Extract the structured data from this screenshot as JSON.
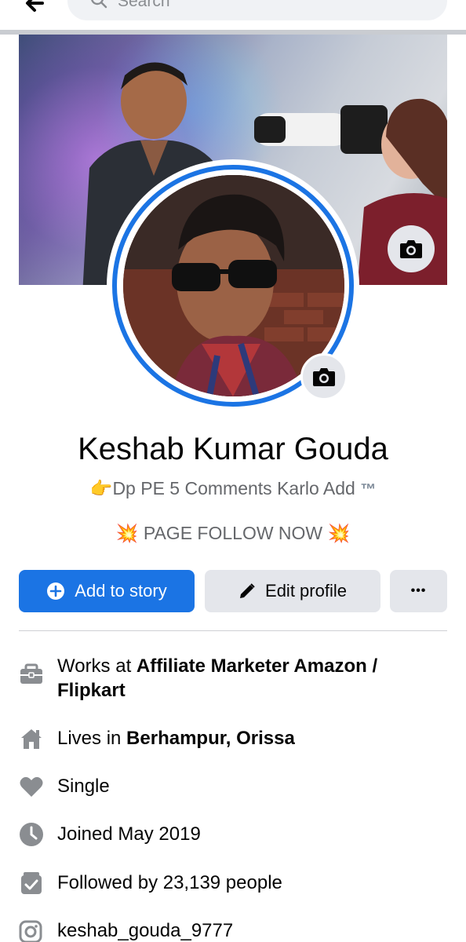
{
  "search": {
    "placeholder": "Search"
  },
  "profile": {
    "name": "Keshab Kumar Gouda",
    "bio_line1_emoji": "👉",
    "bio_line1": "Dp PE 5 Comments Karlo Add",
    "bio_line1_tm": "™",
    "bio_line2_emoji_left": "💥",
    "bio_line2": "PAGE FOLLOW NOW",
    "bio_line2_emoji_right": "💥"
  },
  "buttons": {
    "add_story": "Add to story",
    "edit_profile": "Edit profile",
    "more": "•••"
  },
  "info": {
    "work_prefix": "Works at ",
    "work_value": "Affiliate Marketer Amazon / Flipkart",
    "lives_prefix": "Lives in ",
    "lives_value": "Berhampur, Orissa",
    "relationship": "Single",
    "joined": "Joined May 2019",
    "followers": "Followed by 23,139 people",
    "instagram": "keshab_gouda_9777"
  },
  "icons": {
    "back": "back-arrow-icon",
    "search": "search-icon",
    "camera": "camera-icon",
    "plus": "plus-circle-icon",
    "pencil": "pencil-icon",
    "work": "briefcase-icon",
    "home": "home-icon",
    "heart": "heart-icon",
    "clock": "clock-icon",
    "followers": "followers-icon",
    "instagram": "instagram-icon"
  },
  "colors": {
    "accent": "#1b74e4",
    "secondary_button": "#e4e6eb",
    "muted_text": "#65676b",
    "icon_gray": "#8a8d91"
  }
}
